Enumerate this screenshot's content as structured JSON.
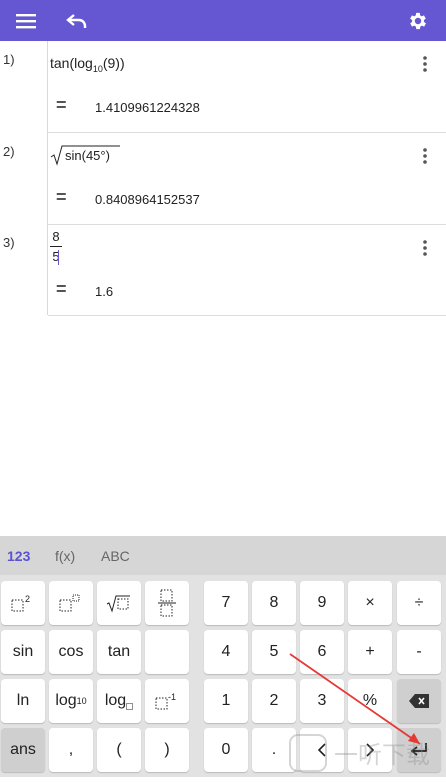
{
  "app": {
    "toolbar": {
      "menu_icon": "hamburger-menu-icon",
      "undo_icon": "undo-icon",
      "settings_icon": "gear-icon",
      "bar_color": "#6557d2"
    },
    "entries": [
      {
        "number": "1)",
        "expression": "tan(log10(9))",
        "expr_parts": [
          "tan(log",
          "10",
          "(9))"
        ],
        "equals": "=",
        "result": "1.4109961224328"
      },
      {
        "number": "2)",
        "expression": "sqrt(sin(45°))",
        "sqrt_inner": "sin(45°)",
        "equals": "=",
        "result": "0.8408964152537"
      },
      {
        "number": "3)",
        "numerator": "8",
        "denominator": "5",
        "equals": "=",
        "result": "1.6"
      }
    ]
  },
  "keyboard": {
    "tabs": [
      "123",
      "f(x)",
      "ABC"
    ],
    "active_tab": "123",
    "active_color": "#5a52d1",
    "row1_left": [
      "x²",
      "x^y",
      "√x",
      "frac"
    ],
    "row2_left": [
      "sin",
      "cos",
      "tan",
      ""
    ],
    "row3_left": [
      "ln",
      "log10",
      "log_b",
      "x⁻¹"
    ],
    "row4_left": [
      "ans",
      ",",
      "(",
      ")"
    ],
    "row1_right": [
      "7",
      "8",
      "9",
      "×",
      "÷"
    ],
    "row2_right": [
      "4",
      "5",
      "6",
      "+",
      "-"
    ],
    "row3_right": [
      "1",
      "2",
      "3",
      "%",
      "backspace"
    ],
    "row4_right": [
      "0",
      ".",
      "<",
      ">",
      "enter"
    ],
    "log10_main": "log",
    "log10_sub": "10",
    "logb_main": "log",
    "watermark_text": "一听下载"
  }
}
